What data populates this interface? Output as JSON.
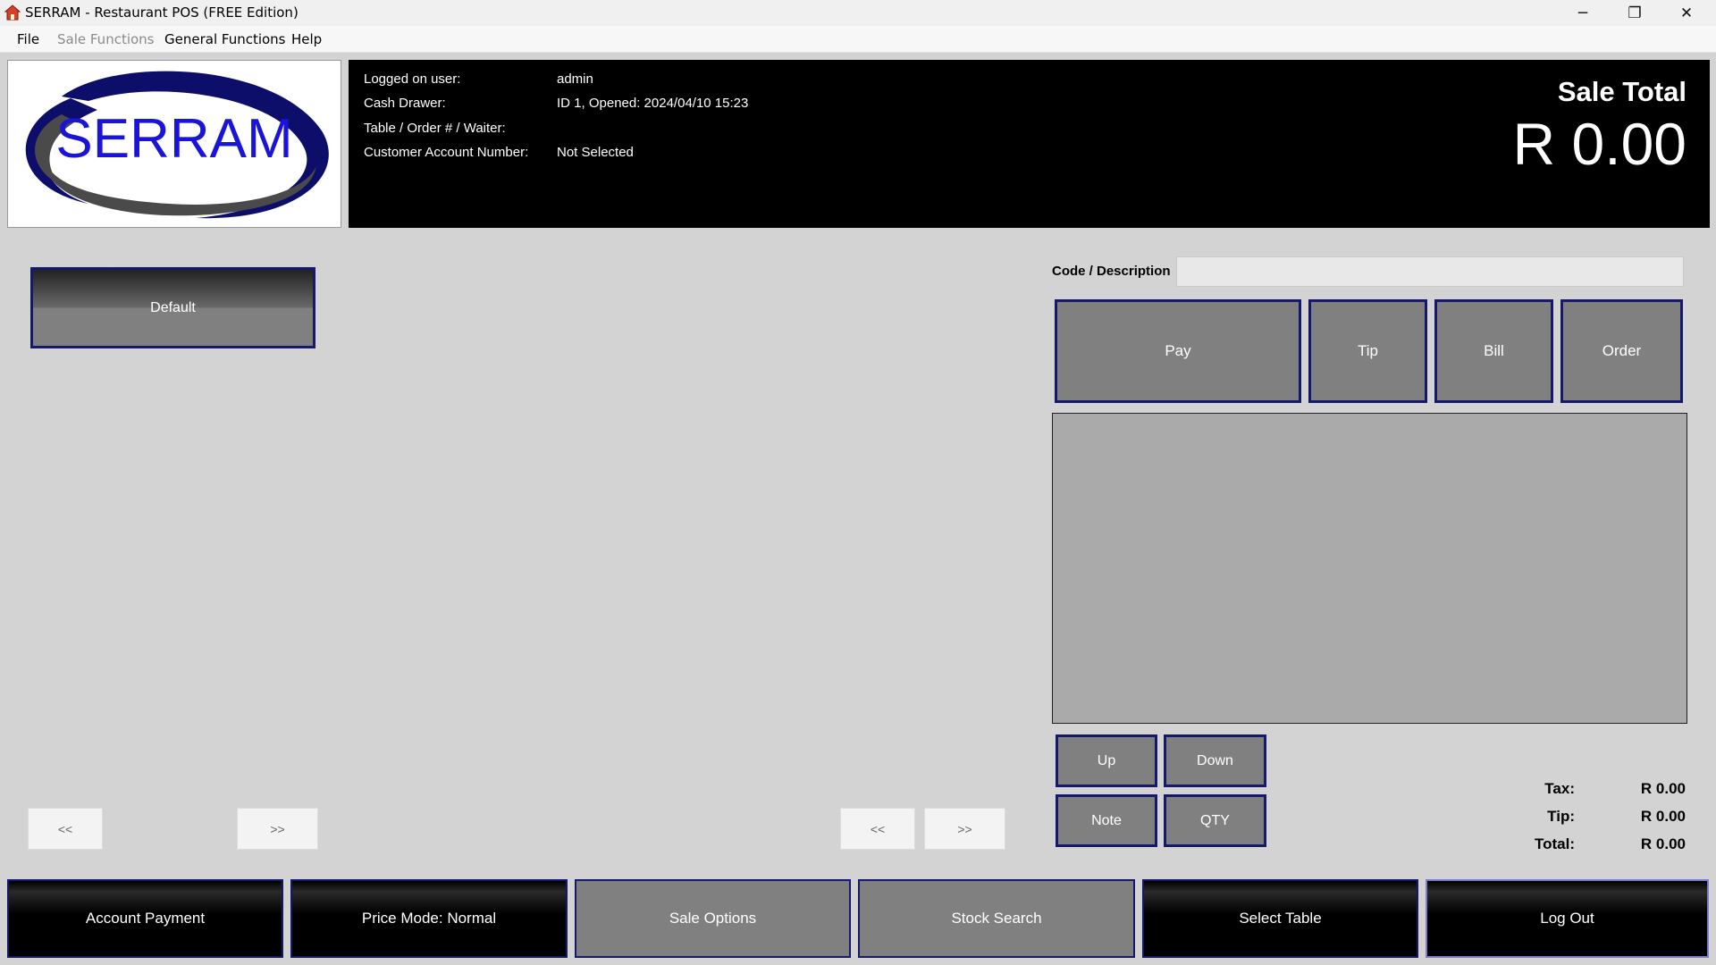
{
  "window": {
    "title": "SERRAM - Restaurant POS (FREE Edition)",
    "controls": {
      "minimize": "─",
      "restore": "❐",
      "close": "✕"
    }
  },
  "menu": [
    {
      "label": "File",
      "enabled": true
    },
    {
      "label": "Sale Functions",
      "enabled": false
    },
    {
      "label": "General Functions",
      "enabled": true
    },
    {
      "label": "Help",
      "enabled": true
    }
  ],
  "logo": {
    "text": "SERRAM",
    "colors": {
      "primary": "#1a13d8",
      "ring_outer": "#0c0e6a",
      "ring_gray": "#4a4a4a"
    }
  },
  "info": {
    "logged_on_user_label": "Logged on user:",
    "logged_on_user_value": "admin",
    "cash_drawer_label": "Cash Drawer:",
    "cash_drawer_value": "ID 1, Opened: 2024/04/10 15:23",
    "table_label": "Table / Order # / Waiter:",
    "table_value": "",
    "customer_label": "Customer Account Number:",
    "customer_value": "Not Selected"
  },
  "sale_total": {
    "title": "Sale Total",
    "value": "R 0.00"
  },
  "categories": {
    "default_label": "Default"
  },
  "nav": {
    "prev": "<<",
    "next": ">>"
  },
  "code": {
    "label": "Code / Description",
    "value": "",
    "placeholder": ""
  },
  "actions": {
    "pay": "Pay",
    "tip": "Tip",
    "bill": "Bill",
    "order": "Order"
  },
  "list_controls": {
    "up": "Up",
    "down": "Down",
    "note": "Note",
    "qty": "QTY"
  },
  "totals": {
    "tax_label": "Tax:",
    "tax_value": "R 0.00",
    "tip_label": "Tip:",
    "tip_value": "R 0.00",
    "total_label": "Total:",
    "total_value": "R 0.00"
  },
  "bottom_bar": {
    "account_payment": "Account Payment",
    "price_mode": "Price Mode: Normal",
    "sale_options": "Sale Options",
    "stock_search": "Stock Search",
    "select_table": "Select Table",
    "log_out": "Log Out"
  },
  "colors": {
    "border_accent": "#16186b",
    "background": "#d3d3d3",
    "list_bg": "#aaaaaa"
  }
}
